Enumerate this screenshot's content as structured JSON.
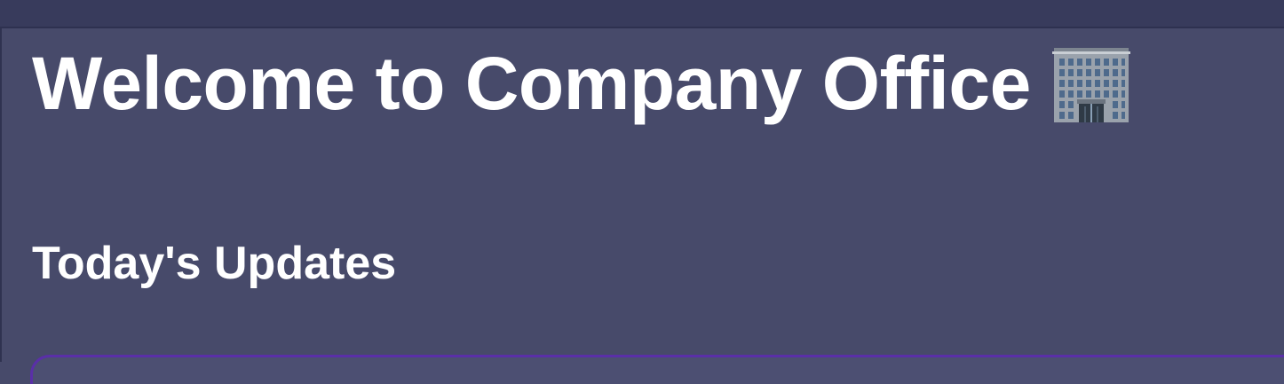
{
  "header": {
    "title": "Welcome to Company Office",
    "title_icon": "office-building-icon"
  },
  "updates": {
    "heading": "Today's Updates"
  },
  "colors": {
    "background": "#474a6a",
    "top_bar": "#383b5c",
    "text": "#ffffff",
    "card_accent": "#5a2fa8"
  }
}
